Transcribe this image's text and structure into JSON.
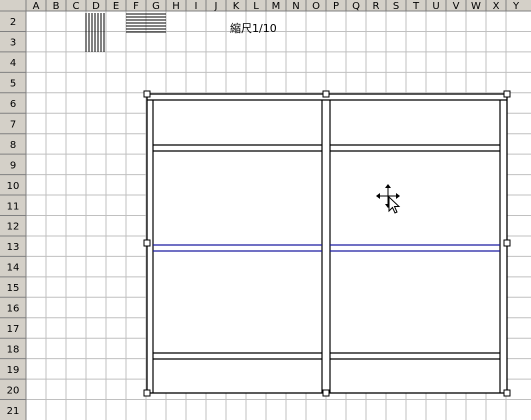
{
  "spreadsheet": {
    "column_headers": [
      "A",
      "B",
      "C",
      "D",
      "E",
      "F",
      "G",
      "H",
      "I",
      "J",
      "K",
      "L",
      "M",
      "N",
      "O",
      "P",
      "Q",
      "R",
      "S",
      "T",
      "U",
      "V",
      "W",
      "X",
      "Y"
    ],
    "row_headers": [
      "2",
      "3",
      "4",
      "5",
      "6",
      "7",
      "8",
      "9",
      "10",
      "11",
      "12",
      "13",
      "14",
      "15",
      "16",
      "17",
      "18",
      "19",
      "20",
      "21"
    ],
    "caption": "縮尺1/10"
  },
  "colors": {
    "header_bg": "#d4d0c8",
    "gridline": "#c0c0c0",
    "drawing_line": "#000000",
    "center_line": "#1a1aa0"
  },
  "icons": {
    "cursor": "move-cursor-icon",
    "pattern_vertical": "vertical-line-pattern-icon",
    "pattern_horizontal": "horizontal-line-pattern-icon"
  }
}
